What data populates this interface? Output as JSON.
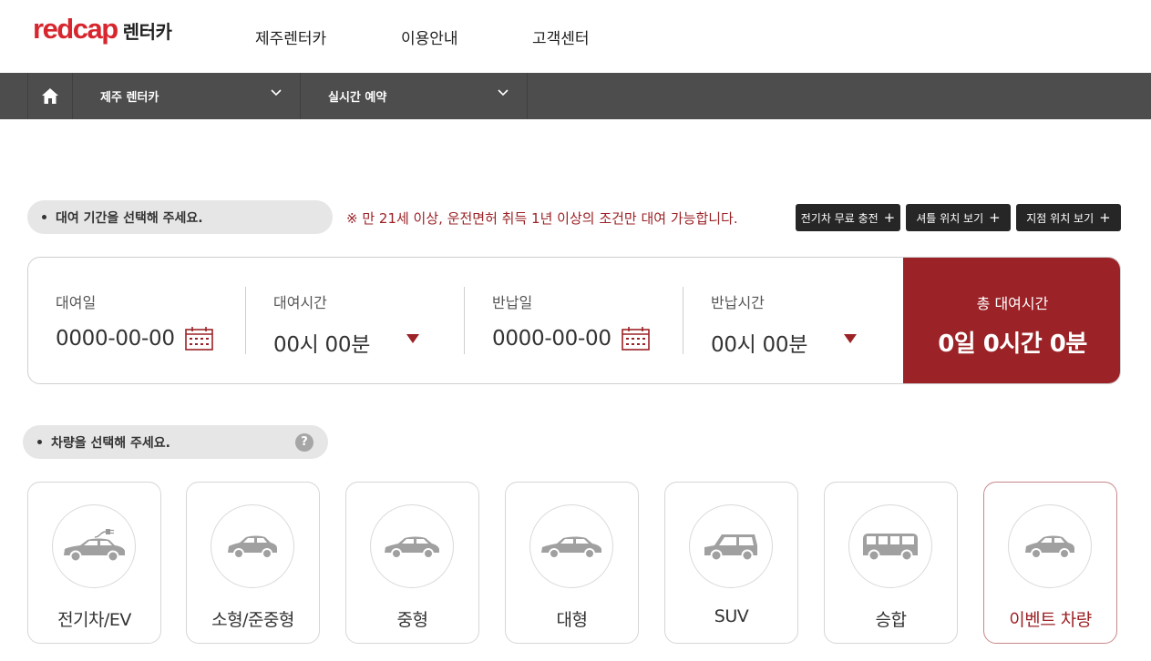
{
  "header": {
    "logo_mark": "redcap",
    "logo_sub": "렌터카",
    "nav": [
      "제주렌터카",
      "이용안내",
      "고객센터"
    ]
  },
  "subnav": {
    "home_icon": "home-icon",
    "crumb1": "제주 렌터카",
    "crumb2": "실시간 예약"
  },
  "period": {
    "pill_text": "대여 기간을 선택해 주세요.",
    "notice": "※ 만 21세 이상, 운전면허 취득 1년 이상의 조건만 대여 가능합니다.",
    "buttons": [
      "전기차 무료 충전",
      "셔틀 위치 보기",
      "지점 위치 보기"
    ]
  },
  "booking": {
    "rent_date_label": "대여일",
    "rent_date_value": "0000-00-00",
    "rent_time_label": "대여시간",
    "rent_time_value": "00시 00분",
    "return_date_label": "반납일",
    "return_date_value": "0000-00-00",
    "return_time_label": "반납시간",
    "return_time_value": "00시 00분",
    "total_label": "총 대여시간",
    "total_value": "0일 0시간 0분"
  },
  "vehicle": {
    "pill_text": "차량을 선택해 주세요.",
    "help_icon": "?",
    "categories": [
      "전기차/EV",
      "소형/준중형",
      "중형",
      "대형",
      "SUV",
      "승합",
      "이벤트 차량"
    ]
  },
  "colors": {
    "brand_red": "#d7262e",
    "accent_dark_red": "#9b2226",
    "subnav_bg": "#4d4d4d"
  }
}
